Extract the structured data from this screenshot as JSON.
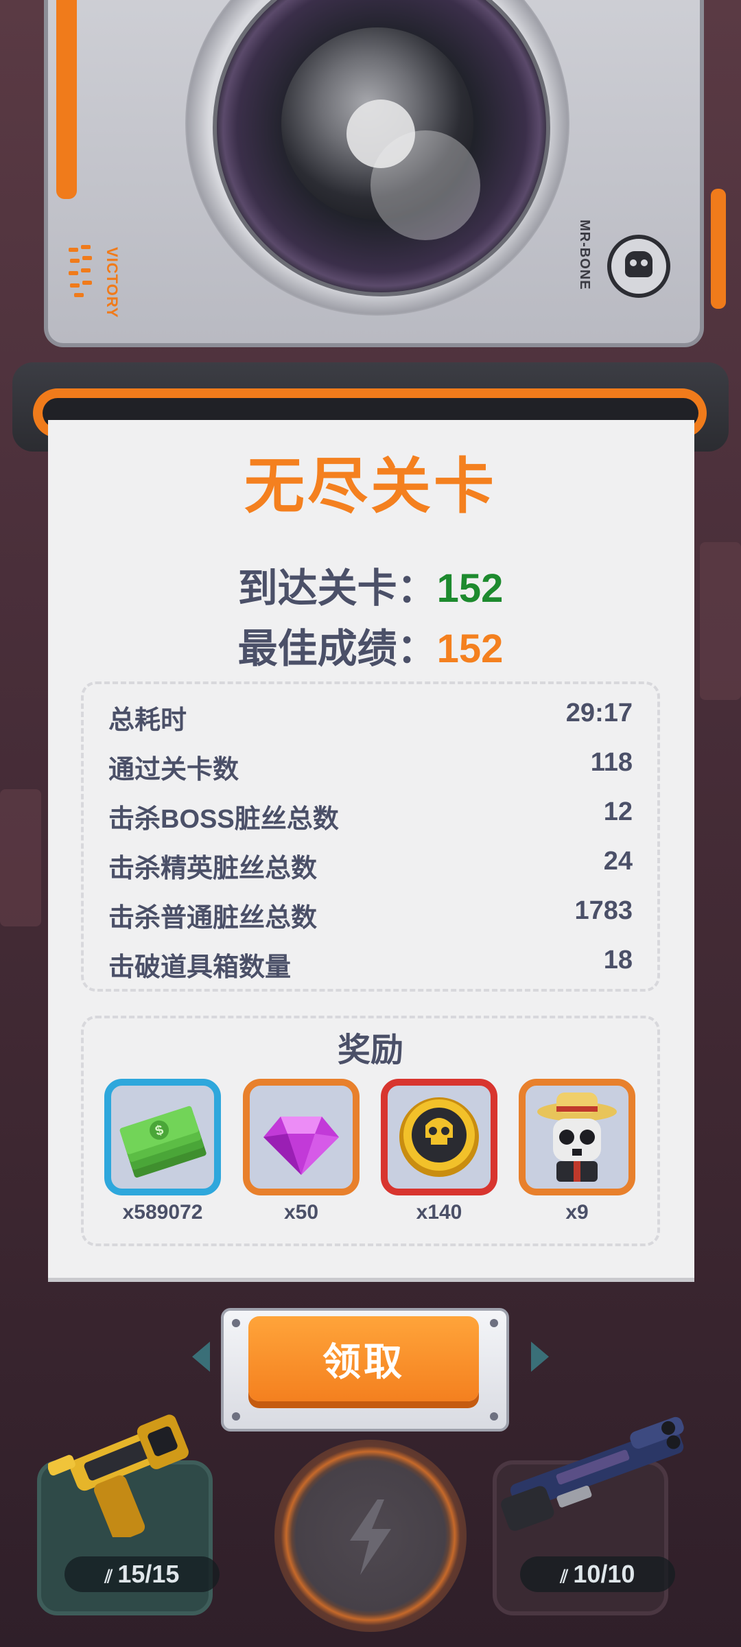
{
  "camera": {
    "side_text": "VICTORY",
    "brand_text": "MR-BONE"
  },
  "result": {
    "title": "无尽关卡",
    "reached_label": "到达关卡：",
    "reached_value": "152",
    "best_label": "最佳成绩：",
    "best_value": "152"
  },
  "stats": [
    {
      "label": "总耗时",
      "value": "29:17"
    },
    {
      "label": "通过关卡数",
      "value": "118"
    },
    {
      "label": "击杀BOSS脏丝总数",
      "value": "12"
    },
    {
      "label": "击杀精英脏丝总数",
      "value": "24"
    },
    {
      "label": "击杀普通脏丝总数",
      "value": "1783"
    },
    {
      "label": "击破道具箱数量",
      "value": "18"
    }
  ],
  "rewards": {
    "title": "奖励",
    "items": [
      {
        "icon": "cash-stack-icon",
        "quantity": "x589072",
        "frame_color": "#2ea7dc"
      },
      {
        "icon": "purple-gem-icon",
        "quantity": "x50",
        "frame_color": "#e8802c"
      },
      {
        "icon": "gold-skull-coin-icon",
        "quantity": "x140",
        "frame_color": "#d8352f"
      },
      {
        "icon": "skeleton-straw-hat-character-icon",
        "quantity": "x9",
        "frame_color": "#e8802c"
      }
    ]
  },
  "claim_button": {
    "label": "领取"
  },
  "weapons": {
    "left": {
      "icon": "golden-pistol-icon",
      "ammo": "15/15"
    },
    "right": {
      "icon": "shotgun-icon",
      "ammo": "10/10"
    }
  },
  "colors": {
    "accent_orange": "#f4801f",
    "value_green": "#1d8a2e",
    "text_dark": "#4b5068"
  }
}
